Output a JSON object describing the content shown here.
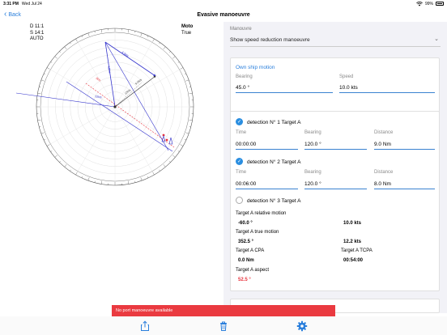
{
  "status": {
    "time": "3:31 PM",
    "date": "Wed Jul 24",
    "battery": "99%"
  },
  "nav": {
    "back_label": "Back",
    "title": "Evasive manoeuvre"
  },
  "plot_info": {
    "left_lines": [
      "D 11:1",
      "S 14:1",
      "AUTO"
    ],
    "mode": "Moto",
    "motion": "True"
  },
  "plot_labels": {
    "vector_a": "4.0kts",
    "vector_b": "10kts",
    "vector_c": "12kts",
    "vector_d": "9.0kts",
    "vector_e": "3kts",
    "vector_f": "12kts"
  },
  "manoeuvre": {
    "label": "Manouvre",
    "value": "Show speed reduction manoeuvre"
  },
  "own_ship": {
    "title": "Own ship motion",
    "bearing_label": "Bearing",
    "bearing_value": "45.0 °",
    "speed_label": "Speed",
    "speed_value": "10.0 kts"
  },
  "detections": [
    {
      "title": "detection N° 1 Target A",
      "time_label": "Time",
      "time": "00:00:00",
      "bearing_label": "Bearing",
      "bearing": "120.0 °",
      "distance_label": "Distance",
      "distance": "9.0 Nm",
      "checked": true
    },
    {
      "title": "detection N° 2 Target A",
      "time_label": "Time",
      "time": "00:06:00",
      "bearing_label": "Bearing",
      "bearing": "120.0 °",
      "distance_label": "Distance",
      "distance": "8.0 Nm",
      "checked": true
    },
    {
      "title": "detection N° 3 Target A",
      "checked": false
    }
  ],
  "results": {
    "relative_label": "Target A relative motion",
    "relative_bearing": "-60.0 °",
    "relative_speed": "10.0 kts",
    "true_label": "Target A true motion",
    "true_bearing": "352.5 °",
    "true_speed": "12.2 kts",
    "cpa_label": "Target A CPA",
    "cpa_value": "0.0 Nm",
    "tcpa_label": "Target A TCPA",
    "tcpa_value": "00:54:00",
    "aspect_label": "Target A aspect",
    "aspect_value": "52.5 °"
  },
  "toast": "No port manoeuvre available",
  "tabs": [
    "share-icon",
    "trash-icon",
    "gear-icon"
  ],
  "colors": {
    "accent": "#2a7fdc",
    "alert": "#ea3a40",
    "relative": "#3333cc",
    "own": "#e8303a"
  }
}
